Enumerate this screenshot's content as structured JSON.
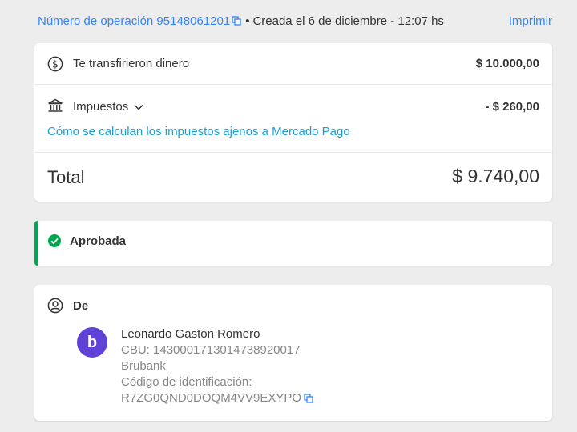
{
  "header": {
    "operation_label": "Número de operación 95148061201",
    "separator": "•",
    "created": "Creada el 6 de diciembre - 12:07 hs",
    "print_label": "Imprimir"
  },
  "summary": {
    "transfer_label": "Te transfirieron dinero",
    "transfer_amount": "$ 10.000,00",
    "taxes_label": "Impuestos",
    "taxes_amount": "- $ 260,00",
    "taxes_link": "Cómo se calculan los impuestos ajenos a Mercado Pago",
    "total_label": "Total",
    "total_amount": "$ 9.740,00"
  },
  "status": {
    "label": "Aprobada",
    "color": "#00a650"
  },
  "sender": {
    "section_label": "De",
    "avatar_letter": "b",
    "name": "Leonardo Gaston Romero",
    "cbu": "CBU: 1430001713014738920017",
    "bank": "Brubank",
    "id_label": "Código de identificación:",
    "id_value": "R7ZG0QND0DOQM4VV9EXYPO"
  },
  "colors": {
    "accent": "#3483fa",
    "link": "#1aa0d4",
    "avatar": "#6142d6"
  }
}
